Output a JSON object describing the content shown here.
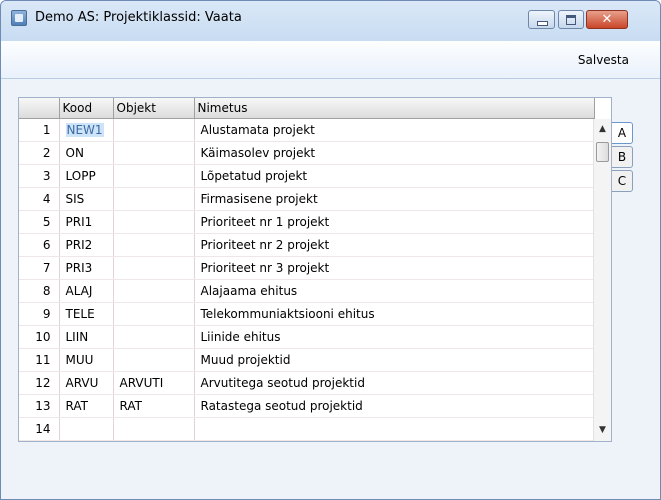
{
  "window": {
    "title": "Demo AS: Projektiklassid: Vaata",
    "close_glyph": "✕"
  },
  "toolbar": {
    "save_label": "Salvesta"
  },
  "grid": {
    "columns": [
      "",
      "Kood",
      "Objekt",
      "Nimetus"
    ],
    "rows": [
      {
        "num": "1",
        "code": "NEW1",
        "object": "",
        "name": "Alustamata projekt"
      },
      {
        "num": "2",
        "code": "ON",
        "object": "",
        "name": "Käimasolev projekt"
      },
      {
        "num": "3",
        "code": "LOPP",
        "object": "",
        "name": "Lõpetatud projekt"
      },
      {
        "num": "4",
        "code": "SIS",
        "object": "",
        "name": "Firmasisene projekt"
      },
      {
        "num": "5",
        "code": "PRI1",
        "object": "",
        "name": "Prioriteet nr 1 projekt"
      },
      {
        "num": "6",
        "code": "PRI2",
        "object": "",
        "name": "Prioriteet nr 2 projekt"
      },
      {
        "num": "7",
        "code": "PRI3",
        "object": "",
        "name": "Prioriteet nr 3 projekt"
      },
      {
        "num": "8",
        "code": "ALAJ",
        "object": "",
        "name": "Alajaama ehitus"
      },
      {
        "num": "9",
        "code": "TELE",
        "object": "",
        "name": "Telekommuniaktsiooni ehitus"
      },
      {
        "num": "10",
        "code": "LIIN",
        "object": "",
        "name": "Liinide ehitus"
      },
      {
        "num": "11",
        "code": "MUU",
        "object": "",
        "name": "Muud projektid"
      },
      {
        "num": "12",
        "code": "ARVU",
        "object": "ARVUTI",
        "name": "Arvutitega seotud projektid"
      },
      {
        "num": "13",
        "code": "RAT",
        "object": "RAT",
        "name": "Ratastega seotud projektid"
      },
      {
        "num": "14",
        "code": "",
        "object": "",
        "name": ""
      }
    ]
  },
  "tabs": [
    "A",
    "B",
    "C"
  ],
  "scroll": {
    "up_glyph": "▲",
    "down_glyph": "▼"
  }
}
